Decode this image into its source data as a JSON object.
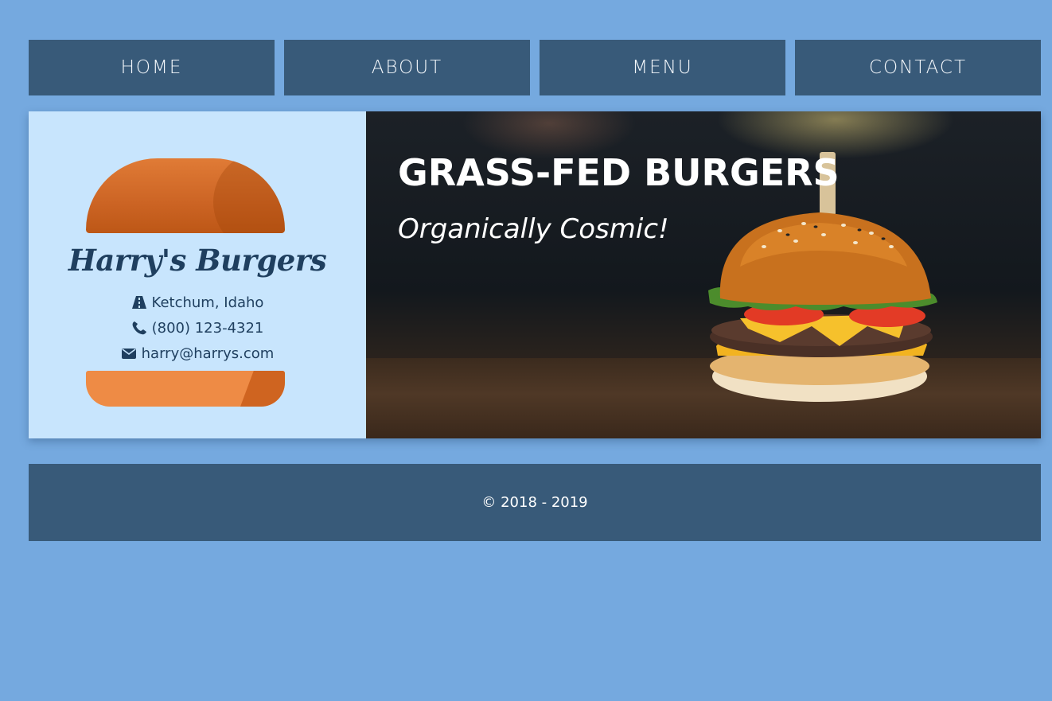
{
  "nav": {
    "items": [
      {
        "label": "HOME"
      },
      {
        "label": "ABOUT"
      },
      {
        "label": "MENU"
      },
      {
        "label": "CONTACT"
      }
    ]
  },
  "brand": {
    "name": "Harry's Burgers",
    "location": "Ketchum, Idaho",
    "phone": "(800) 123-4321",
    "email": "harry@harrys.com",
    "icons": {
      "location": "road-icon",
      "phone": "phone-icon",
      "email": "envelope-icon"
    }
  },
  "banner": {
    "title": "GRASS-FED BURGERS",
    "subtitle": "Organically Cosmic!"
  },
  "footer": {
    "copyright": "© 2018 - 2019"
  },
  "colors": {
    "background": "#75a9df",
    "nav_bg": "#385a79",
    "brand_bg": "#c8e5fd",
    "brand_text": "#1f3f5f",
    "bun": "#e07b36"
  }
}
